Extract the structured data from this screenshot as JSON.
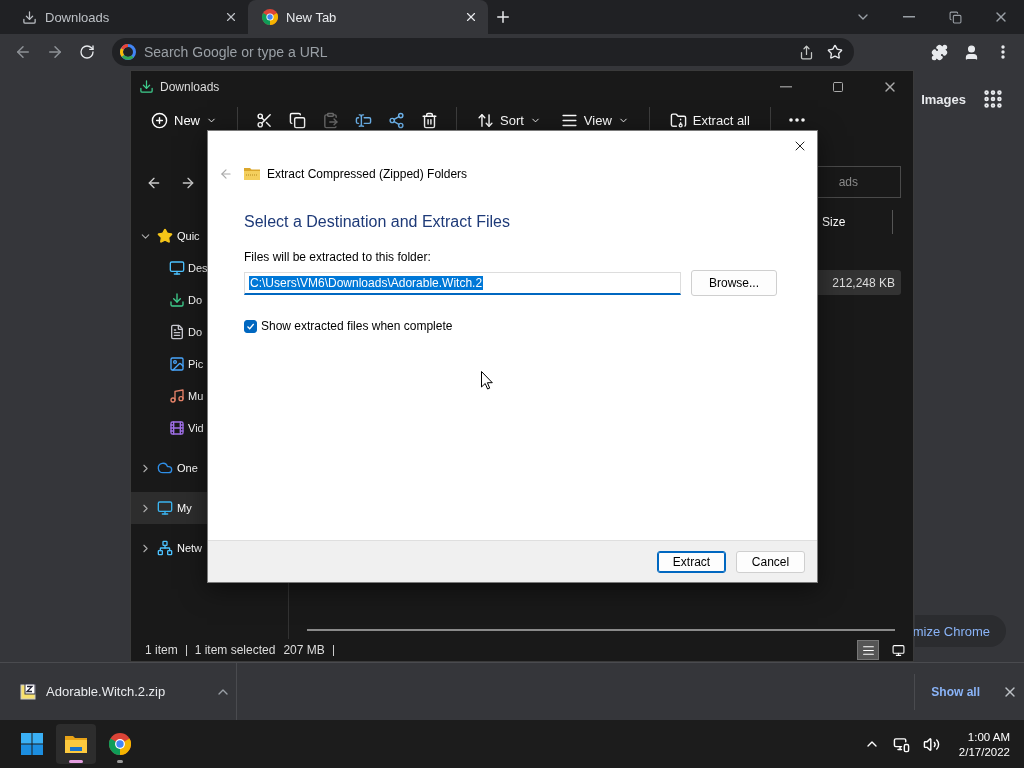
{
  "browser": {
    "tabs": [
      {
        "kind": "downloads",
        "label": "Downloads",
        "selected": false
      },
      {
        "kind": "newtab",
        "label": "New Tab",
        "selected": true
      }
    ],
    "omnibox": {
      "placeholder": "Search Google or type a URL"
    },
    "page": {
      "images_link": "Images",
      "customize_button": "mize Chrome"
    },
    "download_shelf": {
      "file": "Adorable.Witch.2.zip",
      "show_all": "Show all"
    }
  },
  "explorer": {
    "title": "Downloads",
    "toolbar": [
      {
        "kind": "new",
        "label": "New",
        "disabled": false
      },
      {
        "kind": "cut",
        "disabled": false
      },
      {
        "kind": "copy",
        "disabled": false
      },
      {
        "kind": "paste",
        "disabled": true
      },
      {
        "kind": "rename",
        "disabled": false
      },
      {
        "kind": "share",
        "disabled": false
      },
      {
        "kind": "delete",
        "disabled": false
      },
      {
        "kind": "sort",
        "label": "Sort",
        "disabled": false
      },
      {
        "kind": "view",
        "label": "View",
        "disabled": false
      },
      {
        "kind": "extract",
        "label": "Extract all",
        "disabled": false
      },
      {
        "kind": "more",
        "disabled": false
      }
    ],
    "search_placeholder": "ads",
    "columns": [
      "Size"
    ],
    "rows": [
      {
        "size": "212,248 KB",
        "selected": true
      }
    ],
    "sidebar": [
      {
        "kind": "star",
        "label": "Quic",
        "expanded": true,
        "selected": false,
        "children": [
          {
            "kind": "desktop",
            "label": "Des",
            "selected": false
          },
          {
            "kind": "download",
            "label": "Do",
            "selected": false
          },
          {
            "kind": "document",
            "label": "Do",
            "selected": false
          },
          {
            "kind": "picture",
            "label": "Pic",
            "selected": false
          },
          {
            "kind": "music",
            "label": "Mu",
            "selected": false
          },
          {
            "kind": "video",
            "label": "Vid",
            "selected": false
          }
        ]
      },
      {
        "kind": "cloud",
        "label": "One",
        "expanded": false,
        "selected": false
      },
      {
        "kind": "computer",
        "label": "My",
        "expanded": false,
        "selected": true
      },
      {
        "kind": "network",
        "label": "Netw",
        "expanded": false,
        "selected": false
      }
    ],
    "status": [
      "1 item",
      "1 item selected",
      "207 MB"
    ],
    "view_modes": [
      {
        "kind": "details",
        "selected": true
      },
      {
        "kind": "tiles",
        "selected": false
      }
    ]
  },
  "dialog": {
    "title": "Extract Compressed (Zipped) Folders",
    "heading": "Select a Destination and Extract Files",
    "folder_label": "Files will be extracted to this folder:",
    "path": "C:\\Users\\VM6\\Downloads\\Adorable.Witch.2",
    "browse": "Browse...",
    "show_files": {
      "label": "Show extracted files when complete",
      "checked": true
    },
    "buttons": [
      {
        "label": "Extract",
        "default": true
      },
      {
        "label": "Cancel",
        "default": false
      }
    ]
  },
  "taskbar": {
    "apps": [
      {
        "kind": "explorer",
        "active": true
      },
      {
        "kind": "chrome",
        "active": false
      }
    ],
    "time": "1:00 AM",
    "date": "2/17/2022"
  }
}
